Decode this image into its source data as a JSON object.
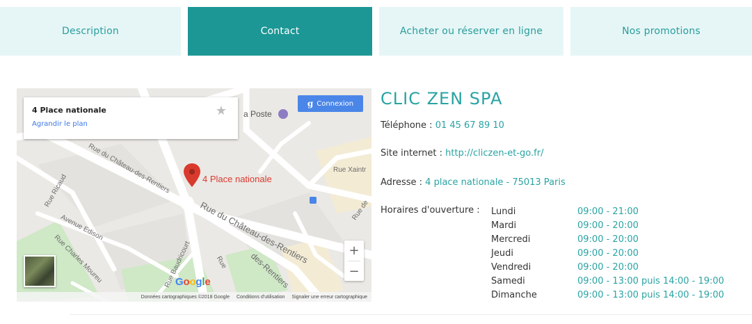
{
  "tabs": [
    {
      "label": "Description",
      "active": false
    },
    {
      "label": "Contact",
      "active": true
    },
    {
      "label": "Acheter ou réserver en ligne",
      "active": false
    },
    {
      "label": "Nos promotions",
      "active": false
    }
  ],
  "map": {
    "card_title": "4 Place nationale",
    "card_link": "Agrandir le plan",
    "signin_label": "Connexion",
    "pin_label": "4 Place nationale",
    "poi_post": "a Poste",
    "streets": {
      "ricaud": "Rue Ricaud",
      "chateau_top": "Rue du Château-des-Rentiers",
      "chateau_mid": "Rue du Château-des-Rentiers",
      "chateau_low": "des-Rentiers",
      "xaintrailles": "Rue Xaintr",
      "edison": "Avenue Edison",
      "charles": "Rue Charles Moureu",
      "baudricourt": "Rue Baudricourt",
      "rue_de": "Rue de",
      "rue_low": "Rue"
    },
    "google_logo": "Google",
    "attribution": [
      "Données cartographiques ©2018 Google",
      "Conditions d'utilisation",
      "Signaler une erreur cartographique"
    ],
    "zoom_in": "+",
    "zoom_out": "−"
  },
  "contact": {
    "name": "CLIC ZEN SPA",
    "phone_label": "Téléphone :",
    "phone": "01 45 67 89 10",
    "site_label": "Site internet :",
    "site": "http://cliczen-et-go.fr/",
    "address_label": "Adresse :",
    "address": "4 place nationale - 75013 Paris",
    "hours_label": "Horaires d'ouverture :",
    "hours": [
      {
        "day": "Lundi",
        "time": "09:00 - 21:00"
      },
      {
        "day": "Mardi",
        "time": "09:00 - 20:00"
      },
      {
        "day": "Mercredi",
        "time": "09:00 - 20:00"
      },
      {
        "day": "Jeudi",
        "time": "09:00 - 20:00"
      },
      {
        "day": "Vendredi",
        "time": "09:00 - 20:00"
      },
      {
        "day": "Samedi",
        "time": "09:00 - 13:00 puis 14:00 - 19:00"
      },
      {
        "day": "Dimanche",
        "time": "09:00 - 13:00 puis 14:00 - 19:00"
      }
    ]
  },
  "colors": {
    "accent": "#1c9796",
    "tab_bg": "#e6f6f6",
    "link": "#2aa3a3",
    "pin": "#d93a2e"
  }
}
